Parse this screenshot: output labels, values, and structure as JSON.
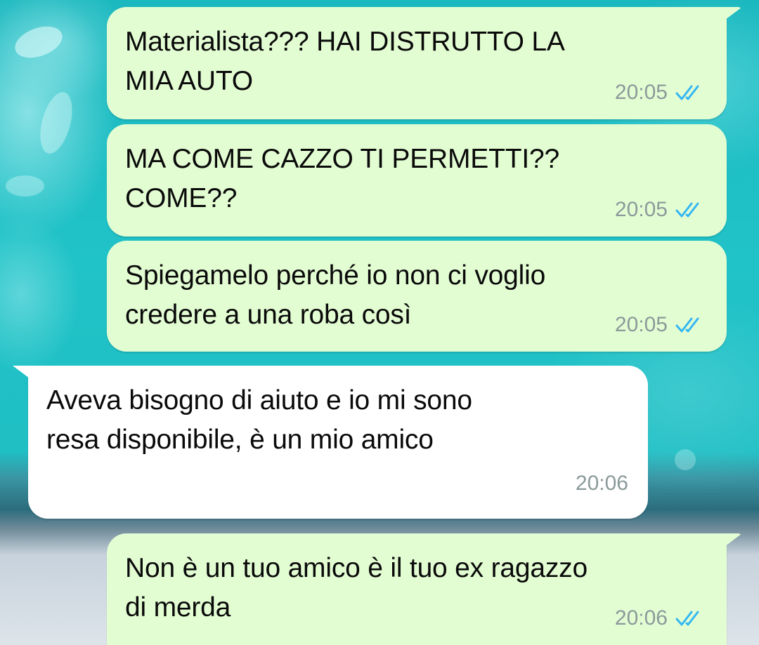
{
  "colors": {
    "outgoing_bubble": "#e3fdd3",
    "incoming_bubble": "#ffffff",
    "read_ticks": "#34b7f1",
    "timestamp": "#8c9a9a"
  },
  "messages": [
    {
      "direction": "outgoing",
      "text": "Materialista??? HAI DISTRUTTO LA\nMIA AUTO",
      "time": "20:05",
      "status": "read-double-check-icon"
    },
    {
      "direction": "outgoing",
      "text": "MA COME CAZZO TI PERMETTI??\nCOME??",
      "time": "20:05",
      "status": "read-double-check-icon"
    },
    {
      "direction": "outgoing",
      "text": "Spiegamelo perché io non ci voglio\ncredere a una roba così",
      "time": "20:05",
      "status": "read-double-check-icon"
    },
    {
      "direction": "incoming",
      "text": "Aveva bisogno di aiuto e io mi sono\nresa disponibile, è un mio amico",
      "time": "20:06"
    },
    {
      "direction": "outgoing",
      "text": "Non è un tuo amico è il tuo ex ragazzo\ndi merda",
      "time": "20:06",
      "status": "read-double-check-icon"
    }
  ]
}
